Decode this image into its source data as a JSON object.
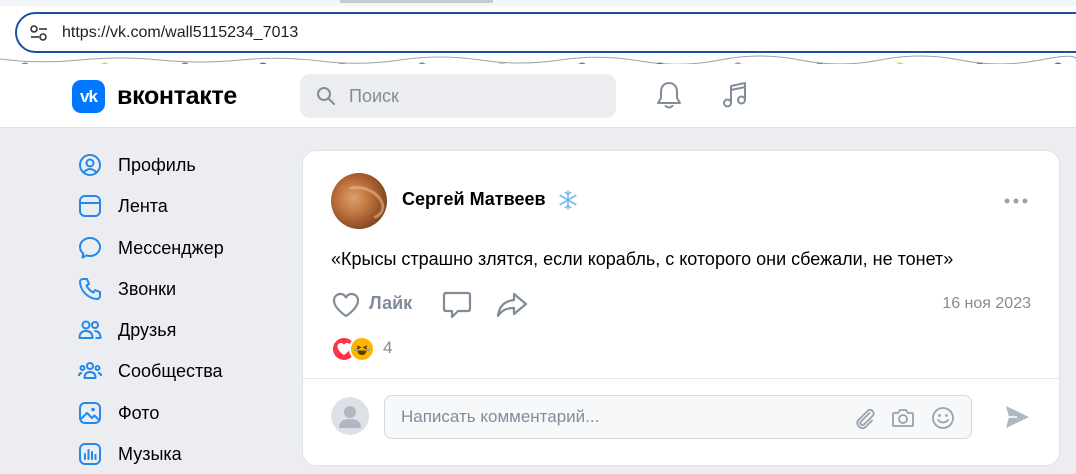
{
  "browser": {
    "url": "https://vk.com/wall5115234_7013"
  },
  "garland_colors": [
    "#1ec95a",
    "#f5d000",
    "#c04be0",
    "#2f7cf6",
    "#ff5ecb"
  ],
  "header": {
    "logo_text": "вконтакте",
    "search_placeholder": "Поиск",
    "icons": [
      "bell-icon",
      "music-icon"
    ]
  },
  "nav": {
    "items": [
      {
        "label": "Профиль",
        "icon": "profile-icon"
      },
      {
        "label": "Лента",
        "icon": "feed-icon"
      },
      {
        "label": "Мессенджер",
        "icon": "messenger-icon"
      },
      {
        "label": "Звонки",
        "icon": "phone-icon"
      },
      {
        "label": "Друзья",
        "icon": "friends-icon"
      },
      {
        "label": "Сообщества",
        "icon": "communities-icon"
      },
      {
        "label": "Фото",
        "icon": "photo-icon"
      },
      {
        "label": "Музыка",
        "icon": "music-icon"
      }
    ]
  },
  "post": {
    "author": "Сергей Матвеев",
    "text": "«Крысы страшно злятся, если корабль, с которого они сбежали, не тонет»",
    "like_label": "Лайк",
    "date": "16 ноя 2023",
    "reactions_count": "4",
    "comment_placeholder": "Написать комментарий..."
  },
  "colors": {
    "accent": "#0077ff",
    "icon": "#2688eb",
    "muted": "#818c99",
    "address_border": "#1f4fa3"
  }
}
